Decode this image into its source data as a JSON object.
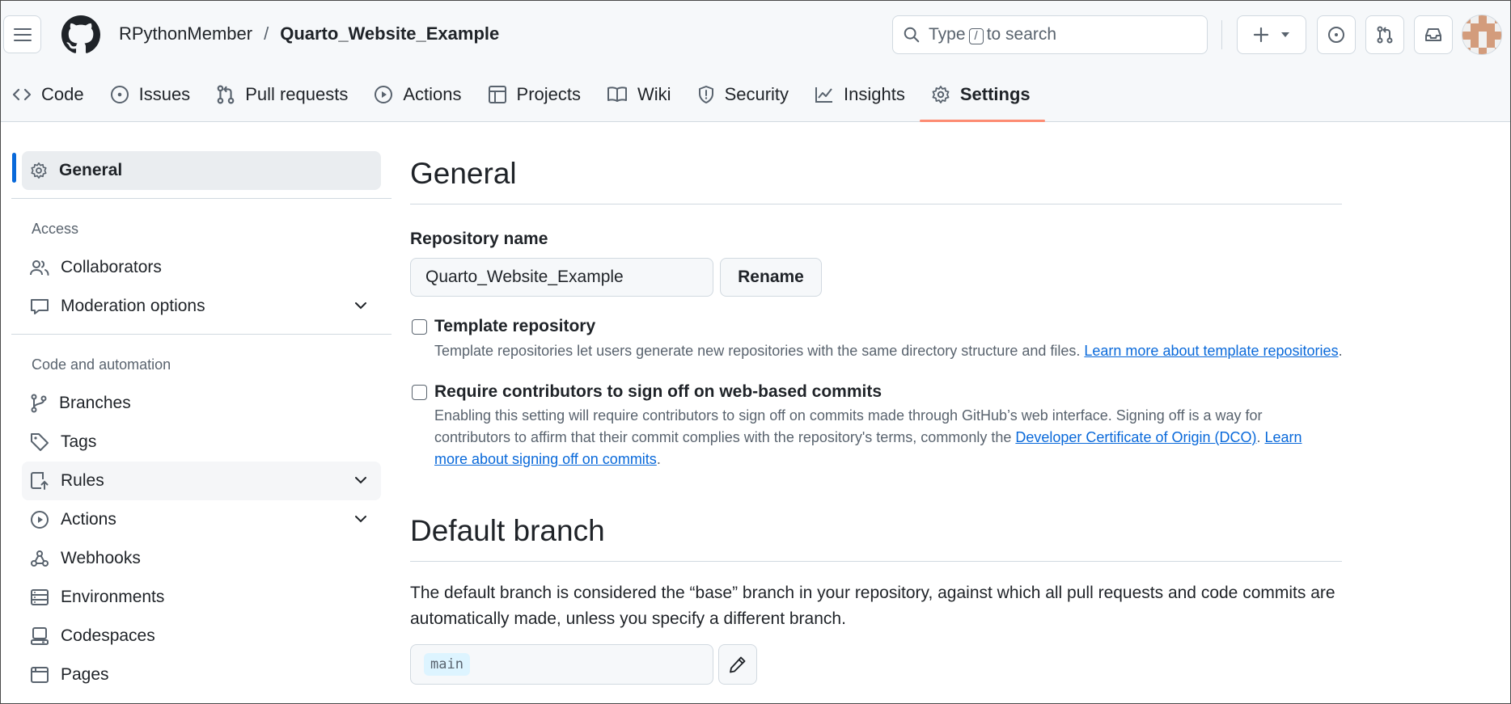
{
  "header": {
    "owner": "RPythonMember",
    "separator": "/",
    "repo": "Quarto_Website_Example",
    "search_prefix": "Type",
    "search_key": "/",
    "search_suffix": "to search"
  },
  "tabs": [
    {
      "label": "Code",
      "icon": "code-icon"
    },
    {
      "label": "Issues",
      "icon": "issue-opened-icon"
    },
    {
      "label": "Pull requests",
      "icon": "git-pull-request-icon"
    },
    {
      "label": "Actions",
      "icon": "play-icon"
    },
    {
      "label": "Projects",
      "icon": "table-icon"
    },
    {
      "label": "Wiki",
      "icon": "book-icon"
    },
    {
      "label": "Security",
      "icon": "shield-icon"
    },
    {
      "label": "Insights",
      "icon": "graph-icon"
    },
    {
      "label": "Settings",
      "icon": "gear-icon",
      "selected": true
    }
  ],
  "sidebar": {
    "general": "General",
    "access_heading": "Access",
    "collaborators": "Collaborators",
    "moderation": "Moderation options",
    "code_heading": "Code and automation",
    "branches": "Branches",
    "tags": "Tags",
    "rules": "Rules",
    "actions": "Actions",
    "webhooks": "Webhooks",
    "environments": "Environments",
    "codespaces": "Codespaces",
    "pages": "Pages"
  },
  "main": {
    "title": "General",
    "repo_name_label": "Repository name",
    "repo_name_value": "Quarto_Website_Example",
    "rename_button": "Rename",
    "template": {
      "label": "Template repository",
      "desc": "Template repositories let users generate new repositories with the same directory structure and files.",
      "link": "Learn more about template repositories",
      "checked": false
    },
    "signoff": {
      "label": "Require contributors to sign off on web-based commits",
      "desc1": "Enabling this setting will require contributors to sign off on commits made through GitHub’s web interface. Signing off is a way for",
      "desc2": "contributors to affirm that their commit complies with the repository's terms, commonly the",
      "link_dco": "Developer Certificate of Origin (DCO)",
      "link_learn_1": "Learn",
      "link_learn_2": "more about signing off on commits",
      "checked": false
    },
    "default_branch_title": "Default branch",
    "default_branch_desc_1": "The default branch is considered the “base” branch in your repository, against which all pull requests and code commits are",
    "default_branch_desc_2": "automatically made, unless you specify a different branch.",
    "branch_value": "main"
  },
  "colors": {
    "accent": "#0969da",
    "tab_underline": "#fd8c73",
    "border": "#d1d9e0",
    "muted": "#59636e"
  }
}
